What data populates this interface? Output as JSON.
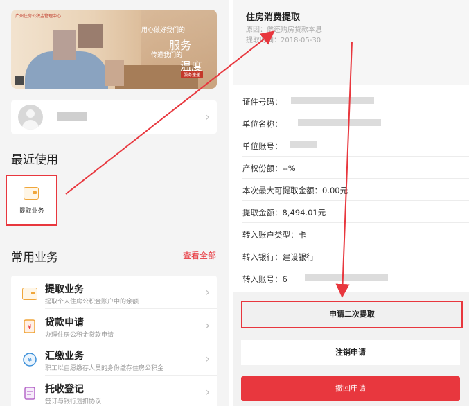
{
  "banner": {
    "brand_text": "广州住房公积金管理中心",
    "slogan_small_1": "用心做好我们的",
    "slogan_big_1": "服务",
    "slogan_small_2": "传递我们的",
    "slogan_big_2": "温度",
    "cta": "服务速递"
  },
  "recent": {
    "title": "最近使用",
    "items": [
      {
        "label": "提取业务",
        "icon": "wallet-icon"
      }
    ]
  },
  "common": {
    "title": "常用业务",
    "view_all": "查看全部",
    "items": [
      {
        "title": "提取业务",
        "subtitle": "提取个人住房公积金账户中的余额",
        "icon": "wallet-icon"
      },
      {
        "title": "贷款申请",
        "subtitle": "办理住房公积金贷款申请",
        "icon": "loan-document-icon"
      },
      {
        "title": "汇缴业务",
        "subtitle": "职工以自愿缴存人员的身份缴存住房公积金",
        "icon": "yen-coin-icon"
      },
      {
        "title": "托收登记",
        "subtitle": "签订与银行划扣协议",
        "icon": "clipboard-icon"
      }
    ]
  },
  "detail": {
    "title": "住房消费提取",
    "reason": "原因：偿还购房贷款本息",
    "date": "提取时间：2018-05-30",
    "fields": [
      {
        "label": "证件号码：",
        "value": ""
      },
      {
        "label": "单位名称：",
        "value": ""
      },
      {
        "label": "单位账号：",
        "value": ""
      },
      {
        "label": "产权份额：",
        "value": "--%"
      },
      {
        "label": "本次最大可提取金额：",
        "value": "0.00元"
      },
      {
        "label": "提取金额：",
        "value": "8,494.01元"
      },
      {
        "label": "转入账户类型：",
        "value": "卡"
      },
      {
        "label": "转入银行：",
        "value": "建设银行"
      },
      {
        "label": "转入账号：",
        "value": "6"
      }
    ],
    "buttons": {
      "second": "申请二次提取",
      "cancel": "注销申请",
      "withdraw": "撤回申请"
    }
  },
  "colors": {
    "accent": "#e8373e",
    "icon_orange": "#f0a63a",
    "icon_blue": "#3b8fd9",
    "icon_purple": "#b668c9"
  }
}
